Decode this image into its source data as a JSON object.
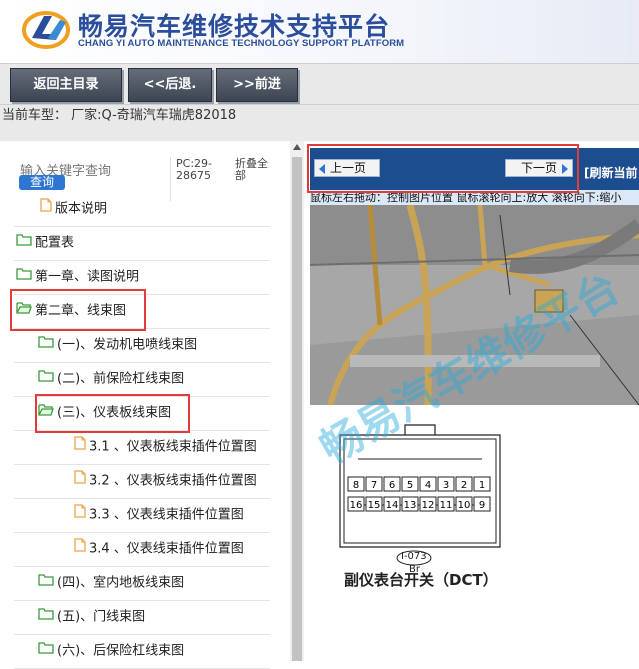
{
  "header": {
    "title": "畅易汽车维修技术支持平台",
    "subtitle": "CHANG YI AUTO MAINTENANCE TECHNOLOGY SUPPORT PLATFORM",
    "logo_icon": "cy-logo-icon",
    "brand_color": "#2a4d9c"
  },
  "toolbar": {
    "home_label": "返回主目录",
    "back_label": "<<后退.",
    "forward_label": ">>前进"
  },
  "car_info": {
    "text": "当前车型： 厂家:Q-奇瑞汽车瑞虎82018"
  },
  "sidebar": {
    "search_placeholder": "输入关键字查询",
    "search_button": "查询",
    "pc_code": "PC:29-28675",
    "collapse_all": "折叠全部",
    "items": [
      {
        "label": "版本说明",
        "icon": "file-icon"
      },
      {
        "label": "配置表",
        "icon": "folder-icon"
      },
      {
        "label": "第一章、读图说明",
        "icon": "folder-icon"
      },
      {
        "label": "第二章、线束图",
        "icon": "folder-open-icon"
      },
      {
        "label": "(一)、发动机电喷线束图",
        "icon": "folder-icon"
      },
      {
        "label": "(二)、前保险杠线束图",
        "icon": "folder-icon"
      },
      {
        "label": "(三)、仪表板线束图",
        "icon": "folder-open-icon"
      },
      {
        "label": "3.1 、仪表板线束插件位置图",
        "icon": "file-icon"
      },
      {
        "label": "3.2 、仪表板线束插件位置图",
        "icon": "file-icon"
      },
      {
        "label": "3.3 、仪表线束插件位置图",
        "icon": "file-icon"
      },
      {
        "label": "3.4 、仪表线束插件位置图",
        "icon": "file-icon"
      },
      {
        "label": "(四)、室内地板线束图",
        "icon": "folder-icon"
      },
      {
        "label": "(五)、门线束图",
        "icon": "folder-icon"
      },
      {
        "label": "(六)、后保险杠线束图",
        "icon": "folder-icon"
      }
    ]
  },
  "viewer": {
    "prev_page": "上一页",
    "next_page": "下一页",
    "refresh": "[刷新当前",
    "hint": "鼠标左右拖动：控制图片位置  鼠标滚轮向上:放大  滚轮向下:缩小",
    "connector_id": "I-073",
    "connector_color": "Br",
    "connector_label": "副仪表台开关（DCT）",
    "pins_row1": [
      "8",
      "7",
      "6",
      "5",
      "4",
      "3",
      "2",
      "1"
    ],
    "pins_row2": [
      "16",
      "15",
      "14",
      "13",
      "12",
      "11",
      "10",
      "9"
    ],
    "watermark": "畅易汽车维修平台"
  },
  "colors": {
    "nav_bar": "#1c4d8e",
    "highlight": "#e23b3b",
    "folder": "#3a9a3a",
    "file": "#e8a44a"
  }
}
